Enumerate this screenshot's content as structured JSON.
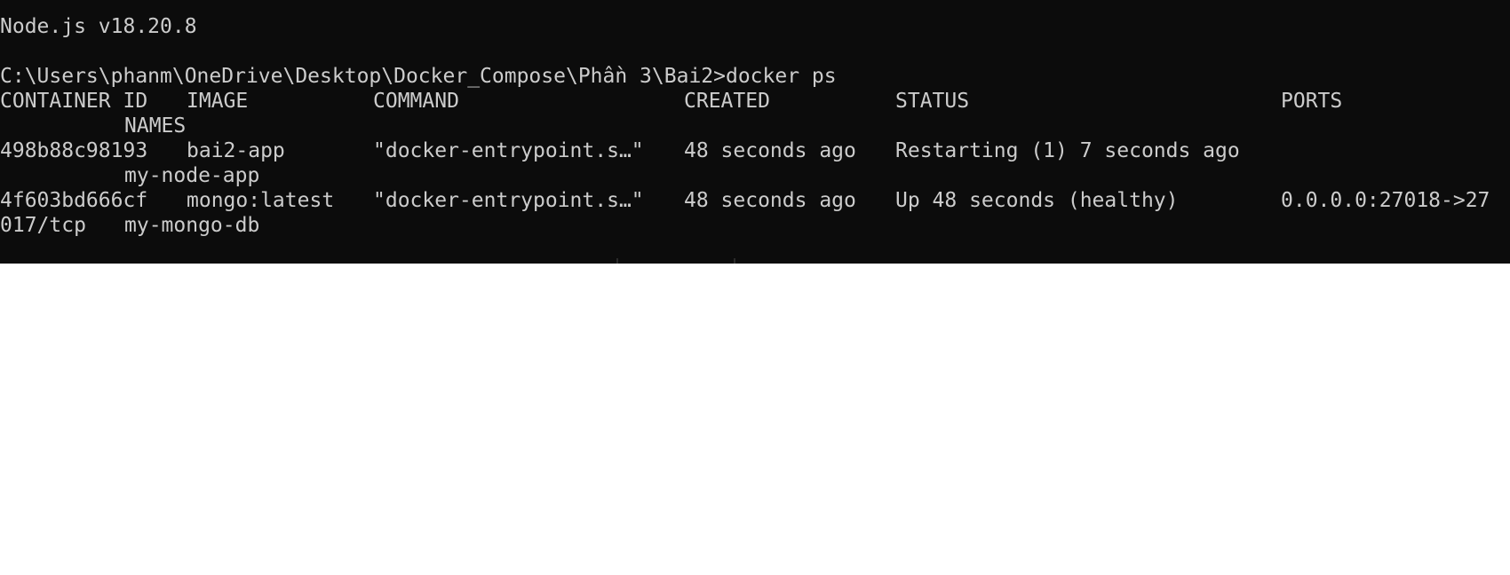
{
  "terminal": {
    "node_version_line": "Node.js v18.20.8",
    "prompt": "C:\\Users\\phanm\\OneDrive\\Desktop\\Docker_Compose\\Phần 3\\Bai2>",
    "command": "docker ps",
    "headers": {
      "container_id": "CONTAINER ID",
      "image": "IMAGE",
      "command": "COMMAND",
      "created": "CREATED",
      "status": "STATUS",
      "ports": "PORTS",
      "names": "NAMES"
    },
    "rows": [
      {
        "container_id": "498b88c98193",
        "image": "bai2-app",
        "command": "\"docker-entrypoint.s…\"",
        "created": "48 seconds ago",
        "status": "Restarting (1) 7 seconds ago",
        "ports": "",
        "names": "my-node-app"
      },
      {
        "container_id": "4f603bd666cf",
        "image": "mongo:latest",
        "command": "\"docker-entrypoint.s…\"",
        "created": "48 seconds ago",
        "status": "Up 48 seconds (healthy)",
        "ports_line1": "0.0.0.0:27018->27",
        "ports_line2": "017/tcp",
        "names": "my-mongo-db"
      }
    ]
  },
  "colors": {
    "background": "#0c0c0c",
    "foreground": "#cccccc",
    "page": "#ffffff"
  }
}
